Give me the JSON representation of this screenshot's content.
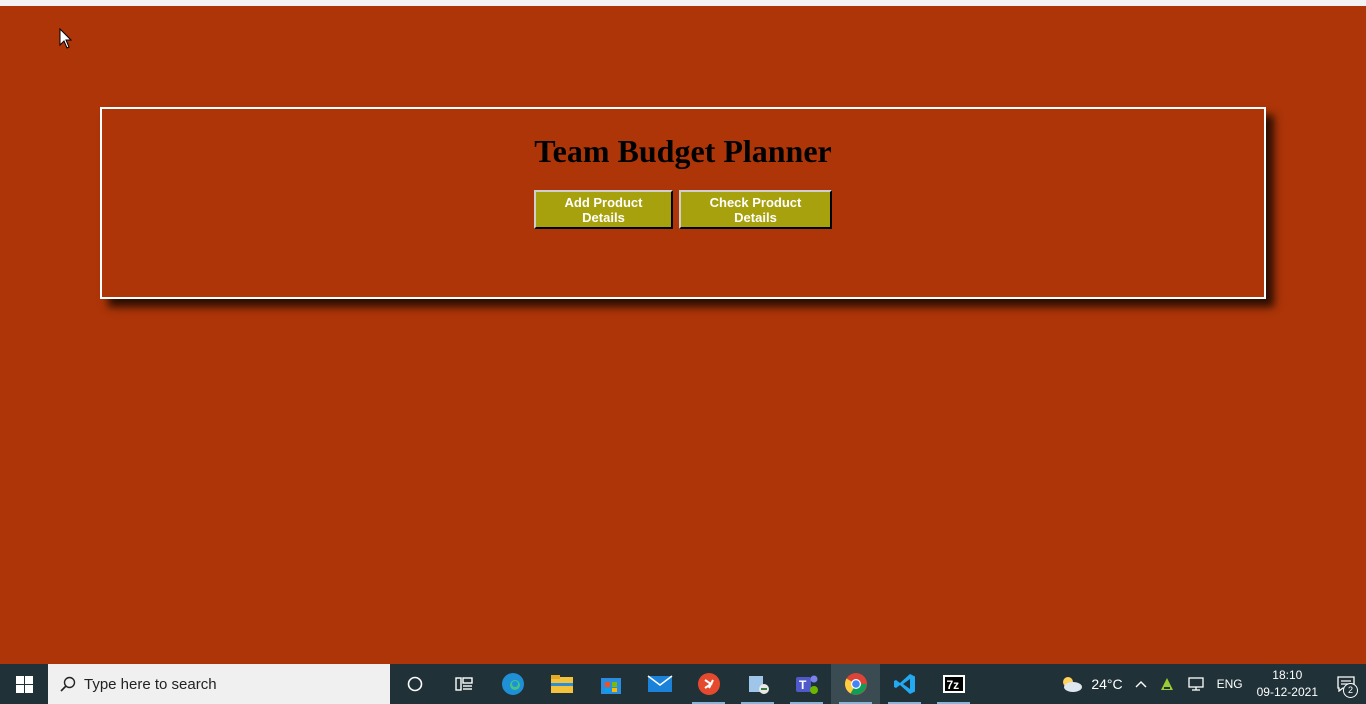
{
  "app": {
    "title": "Team Budget Planner",
    "buttons": {
      "add": "Add Product Details",
      "check": "Check Product Details"
    },
    "colors": {
      "background": "#ad3508",
      "button": "#a8a10e",
      "panel_border": "#ffffff"
    }
  },
  "taskbar": {
    "search_placeholder": "Type here to search",
    "pinned": [
      "cortana-icon",
      "task-view-icon",
      "edge-icon",
      "file-explorer-icon",
      "store-icon",
      "mail-icon",
      "remote-desktop-icon",
      "app-icon",
      "teams-icon",
      "chrome-icon",
      "vscode-icon",
      "7zip-icon"
    ],
    "weather": "24°C",
    "language": "ENG",
    "time": "18:10",
    "date": "09-12-2021",
    "notifications": "2"
  }
}
